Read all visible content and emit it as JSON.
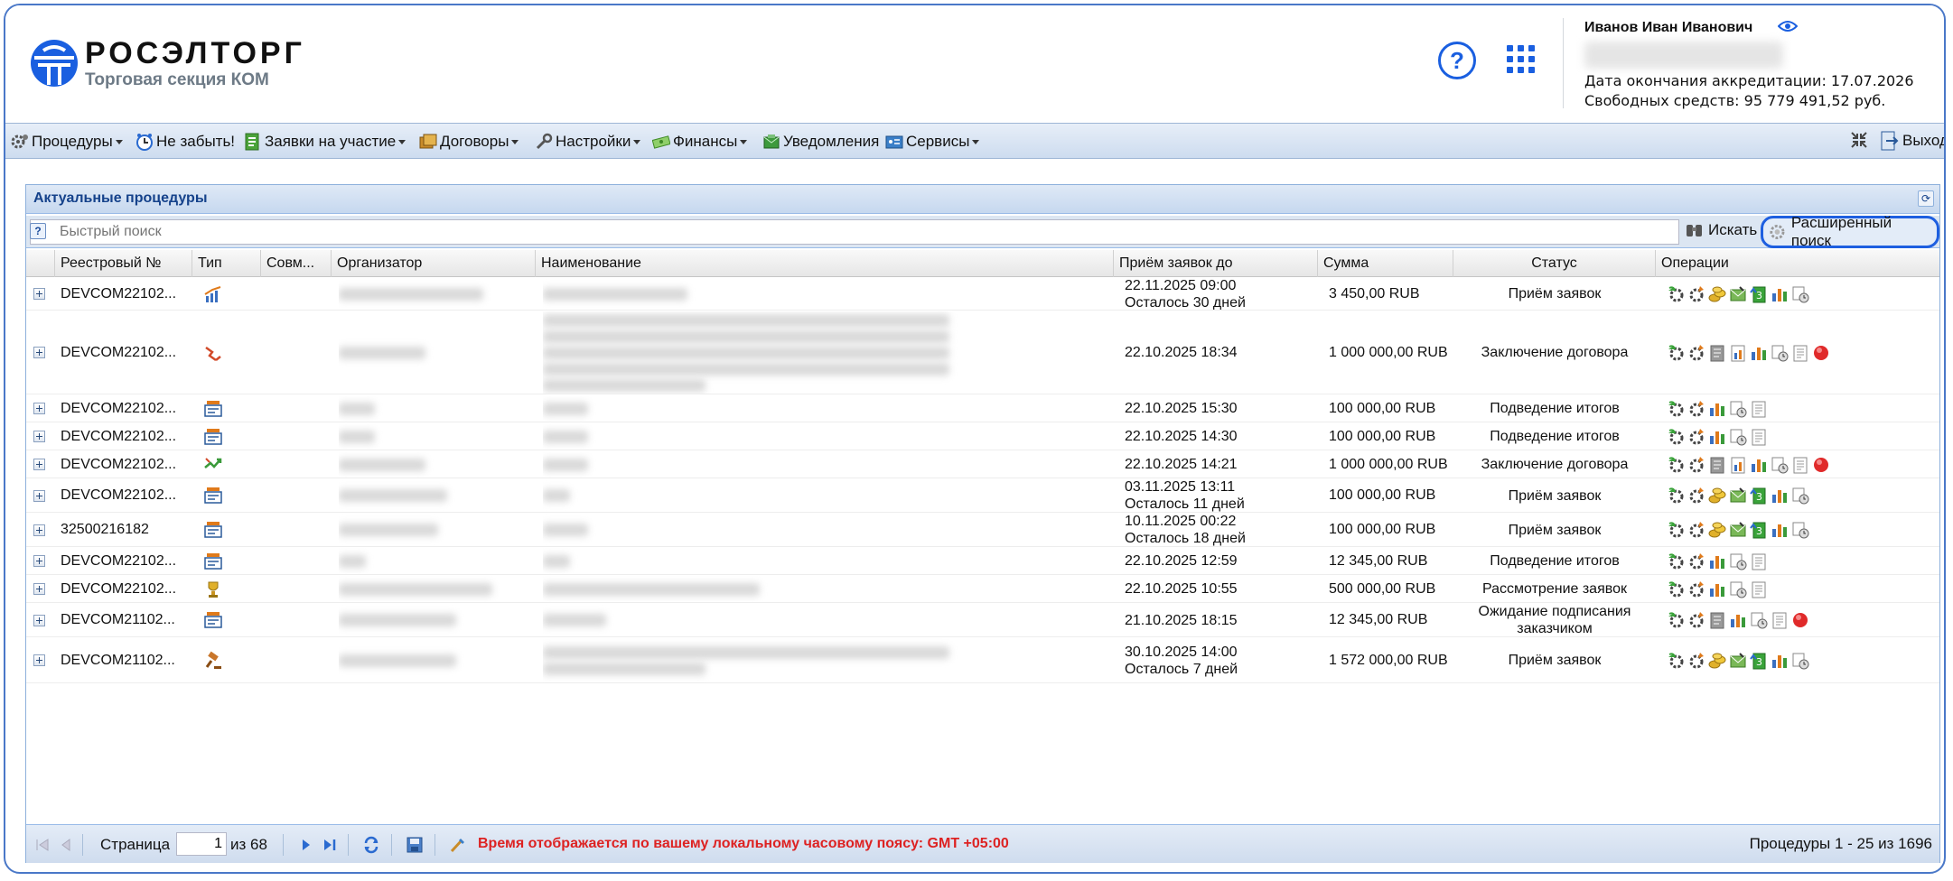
{
  "header": {
    "logo_name": "РОСЭЛТОРГ",
    "logo_subtitle": "Торговая секция КОМ",
    "help_glyph": "?",
    "user_name": "Иванов Иван Иванович",
    "accreditation": "Дата окончания аккредитации: 17.07.2026",
    "funds": "Свободных средств: 95 779 491,52 руб."
  },
  "menu": {
    "items": [
      {
        "label": "Процедуры",
        "icon": "gears-icon",
        "dropdown": true
      },
      {
        "label": "Не забыть!",
        "icon": "clock-icon",
        "dropdown": false
      },
      {
        "label": "Заявки на участие",
        "icon": "application-icon",
        "dropdown": true
      },
      {
        "label": "Договоры",
        "icon": "contracts-icon",
        "dropdown": true
      },
      {
        "label": "Настройки",
        "icon": "wrench-icon",
        "dropdown": true
      },
      {
        "label": "Финансы",
        "icon": "money-icon",
        "dropdown": true
      },
      {
        "label": "Уведомления",
        "icon": "notification-icon",
        "dropdown": false
      },
      {
        "label": "Сервисы",
        "icon": "services-icon",
        "dropdown": true
      }
    ],
    "exit_label": "Выход"
  },
  "panel": {
    "title": "Актуальные процедуры",
    "quick_search_placeholder": "Быстрый поиск",
    "search_label": "Искать",
    "advanced_search_label": "Расширенный поиск"
  },
  "grid": {
    "columns": [
      "Реестровый №",
      "Тип",
      "Совм...",
      "Организатор",
      "Наименование",
      "Приём заявок до",
      "Сумма",
      "Статус",
      "Операции"
    ],
    "rows": [
      {
        "reg": "DEVCOM22102...",
        "type_icon": "chart-up-icon",
        "deadline": "22.11.2025 09:00",
        "remaining": "Осталось 30 дней",
        "sum": "3 450,00 RUB",
        "status": "Приём заявок",
        "ops": [
          "gear-green",
          "gear-orange",
          "coins",
          "envelope",
          "doc-3",
          "bars",
          "clock-gear"
        ]
      },
      {
        "reg": "DEVCOM22102...",
        "type_icon": "hammer-down-icon",
        "deadline": "22.10.2025 18:34",
        "remaining": "",
        "sum": "1 000 000,00 RUB",
        "status": "Заключение договора",
        "ops": [
          "gear-green",
          "gear-orange",
          "doc-gray",
          "chart-doc",
          "bars",
          "clock-gear",
          "doc",
          "red-circle"
        ]
      },
      {
        "reg": "DEVCOM22102...",
        "type_icon": "auction-screen-icon",
        "deadline": "22.10.2025 15:30",
        "remaining": "",
        "sum": "100 000,00 RUB",
        "status": "Подведение итогов",
        "ops": [
          "gear-green",
          "gear-orange",
          "bars",
          "clock-gear",
          "doc"
        ]
      },
      {
        "reg": "DEVCOM22102...",
        "type_icon": "auction-screen-icon",
        "deadline": "22.10.2025 14:30",
        "remaining": "",
        "sum": "100 000,00 RUB",
        "status": "Подведение итогов",
        "ops": [
          "gear-green",
          "gear-orange",
          "bars",
          "clock-gear",
          "doc"
        ]
      },
      {
        "reg": "DEVCOM22102...",
        "type_icon": "trend-up-icon",
        "deadline": "22.10.2025 14:21",
        "remaining": "",
        "sum": "1 000 000,00 RUB",
        "status": "Заключение договора",
        "ops": [
          "gear-green",
          "gear-orange",
          "doc-gray",
          "chart-doc",
          "bars",
          "clock-gear",
          "doc",
          "red-circle"
        ]
      },
      {
        "reg": "DEVCOM22102...",
        "type_icon": "auction-screen-icon",
        "deadline": "03.11.2025 13:11",
        "remaining": "Осталось 11 дней",
        "sum": "100 000,00 RUB",
        "status": "Приём заявок",
        "ops": [
          "gear-green",
          "gear-orange",
          "coins",
          "envelope",
          "doc-3",
          "bars",
          "clock-gear"
        ]
      },
      {
        "reg": "32500216182",
        "type_icon": "auction-screen-icon",
        "deadline": "10.11.2025 00:22",
        "remaining": "Осталось 18 дней",
        "sum": "100 000,00 RUB",
        "status": "Приём заявок",
        "ops": [
          "gear-green",
          "gear-orange",
          "coins",
          "envelope",
          "doc-3",
          "bars",
          "clock-gear"
        ]
      },
      {
        "reg": "DEVCOM22102...",
        "type_icon": "auction-screen-icon",
        "deadline": "22.10.2025 12:59",
        "remaining": "",
        "sum": "12 345,00 RUB",
        "status": "Подведение итогов",
        "ops": [
          "gear-green",
          "gear-orange",
          "bars",
          "clock-gear",
          "doc"
        ]
      },
      {
        "reg": "DEVCOM22102...",
        "type_icon": "trophy-icon",
        "deadline": "22.10.2025 10:55",
        "remaining": "",
        "sum": "500 000,00 RUB",
        "status": "Рассмотрение заявок",
        "ops": [
          "gear-green",
          "gear-orange",
          "bars",
          "clock-gear",
          "doc"
        ]
      },
      {
        "reg": "DEVCOM21102...",
        "type_icon": "auction-screen-icon",
        "deadline": "21.10.2025 18:15",
        "remaining": "",
        "sum": "12 345,00 RUB",
        "status": "Ожидание подписания заказчиком",
        "ops": [
          "gear-green",
          "gear-orange",
          "doc-gray",
          "bars",
          "clock-gear",
          "doc",
          "red-circle"
        ]
      },
      {
        "reg": "DEVCOM21102...",
        "type_icon": "gavel-icon",
        "deadline": "30.10.2025 14:00",
        "remaining": "Осталось 7 дней",
        "sum": "1 572 000,00 RUB",
        "status": "Приём заявок",
        "ops": [
          "gear-green",
          "gear-orange",
          "coins",
          "envelope",
          "doc-3",
          "bars",
          "clock-gear"
        ]
      }
    ]
  },
  "pager": {
    "page_label": "Страница",
    "page_value": "1",
    "of_label": "из 68",
    "timezone_note": "Время отображается по вашему локальному часовому поясу: GMT +05:00",
    "total": "Процедуры 1 - 25 из 1696"
  },
  "colors": {
    "accent": "#1a5fe0",
    "panel_title": "#15428b",
    "warning_text": "#dd2222"
  }
}
